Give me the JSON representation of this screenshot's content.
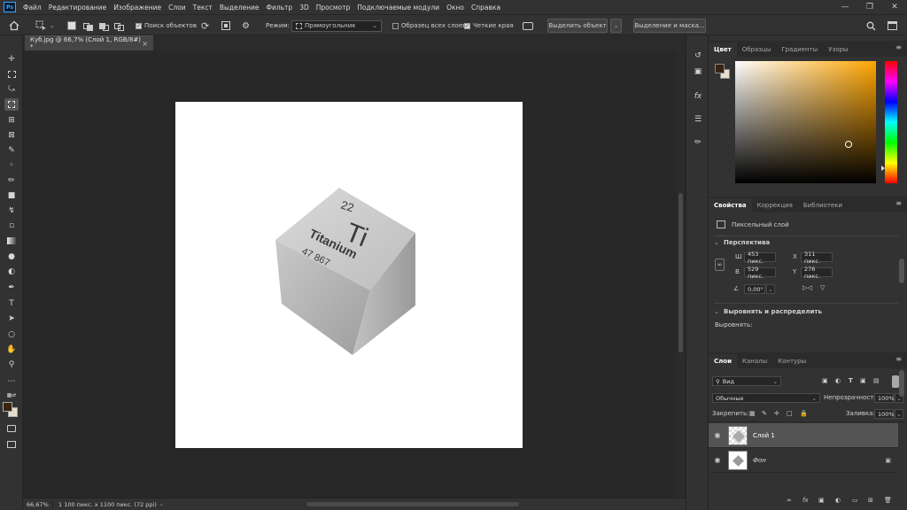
{
  "app": {
    "logo": "Ps"
  },
  "menu": [
    "Файл",
    "Редактирование",
    "Изображение",
    "Слои",
    "Текст",
    "Выделение",
    "Фильтр",
    "3D",
    "Просмотр",
    "Подключаемые модули",
    "Окно",
    "Справка"
  ],
  "options": {
    "search_objects": "Поиск объектов",
    "mode_label": "Режим:",
    "mode_value": "Прямоугольник",
    "sample_all_layers": "Образец всех слоев",
    "hard_edges": "Четкие края",
    "select_object": "Выделить объект",
    "select_and_mask": "Выделение и маска..."
  },
  "document": {
    "tab_title": "Куб.jpg @ 66,7% (Слой 1, RGB/8#) *",
    "zoom": "66,67%",
    "info": "1 100 пикс. x 1100 пикс. (72 ppi)"
  },
  "cube": {
    "number": "22",
    "symbol": "Ti",
    "name": "Titanium",
    "mass": "47 867"
  },
  "color_panel": {
    "tabs": [
      "Цвет",
      "Образцы",
      "Градиенты",
      "Узоры"
    ],
    "foreground": "#3a2410",
    "background": "#e8dccb"
  },
  "properties": {
    "tabs": [
      "Свойства",
      "Коррекция",
      "Библиотеки"
    ],
    "kind": "Пиксельный слой",
    "section_perspective": "Перспектива",
    "w_label": "Ш",
    "w_value": "453 пикс.",
    "h_label": "В",
    "h_value": "529 пикс.",
    "x_label": "X",
    "x_value": "311 пикс.",
    "y_label": "Y",
    "y_value": "276 пикс.",
    "angle": "0,00°",
    "section_align": "Выровнять и распределить",
    "align_label": "Выровнять:"
  },
  "layers_panel": {
    "tabs": [
      "Слои",
      "Каналы",
      "Контуры"
    ],
    "filter": "Вид",
    "blend_mode": "Обычные",
    "opacity_label": "Непрозрачность:",
    "opacity_value": "100%",
    "lock_label": "Закрепить:",
    "fill_label": "Заливка:",
    "fill_value": "100%",
    "layers": [
      {
        "name": "Слой 1",
        "selected": true
      },
      {
        "name": "Фон",
        "selected": false
      }
    ]
  }
}
